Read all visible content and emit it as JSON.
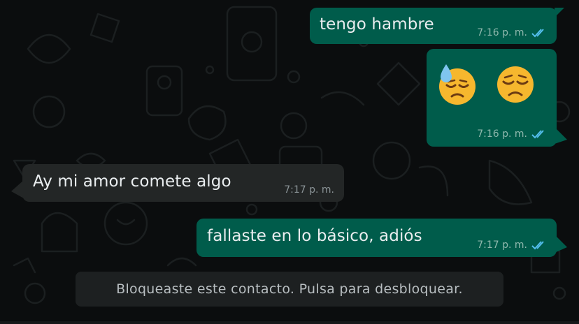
{
  "chat": {
    "messages": [
      {
        "direction": "outgoing",
        "text": "tengo hambre",
        "time": "7:16 p. m.",
        "status": "read"
      },
      {
        "direction": "outgoing",
        "emojis": [
          "downcast-face-with-sweat",
          "disappointed-face"
        ],
        "time": "7:16 p. m.",
        "status": "read"
      },
      {
        "direction": "incoming",
        "text": "Ay mi amor comete algo",
        "time": "7:17 p. m."
      },
      {
        "direction": "outgoing",
        "text": "fallaste en lo básico, adiós",
        "time": "7:17 p. m.",
        "status": "read"
      }
    ],
    "blocked_notice": "Bloqueaste este contacto. Pulsa para desbloquear."
  },
  "colors": {
    "background": "#0b0d0e",
    "outgoing_bubble": "#005c4b",
    "incoming_bubble": "#232626",
    "read_tick": "#53bdeb",
    "notice_bar": "#1d2021"
  },
  "icons": {
    "read_receipt": "double-check-icon",
    "wallpaper": "doodle-pattern"
  }
}
